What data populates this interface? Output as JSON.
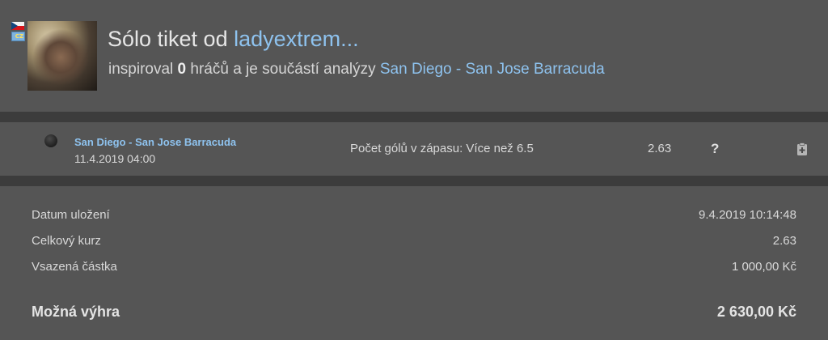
{
  "header": {
    "title_prefix": "Sólo tiket od",
    "username": "ladyextrem...",
    "country_code": "CZ",
    "subtitle_prefix": "inspiroval",
    "inspired_count": "0",
    "subtitle_middle": "hráčů a je součástí analýzy",
    "analysis_link": "San Diego - San Jose Barracuda"
  },
  "bet": {
    "status_icon": "unresolved-dot-icon",
    "match": "San Diego - San Jose Barracuda",
    "datetime": "11.4.2019 04:00",
    "pick": "Počet gólů v zápasu: Více než 6.5",
    "odds": "2.63",
    "help_label": "?",
    "action_icon": "document-icon"
  },
  "summary": {
    "saved_label": "Datum uložení",
    "saved_value": "9.4.2019 10:14:48",
    "total_odds_label": "Celkový kurz",
    "total_odds_value": "2.63",
    "stake_label": "Vsazená částka",
    "stake_value": "1 000,00 Kč",
    "win_label": "Možná výhra",
    "win_value": "2 630,00 Kč"
  },
  "colors": {
    "background": "#555555",
    "band": "#3c3c3c",
    "link": "#8ec2ee"
  }
}
